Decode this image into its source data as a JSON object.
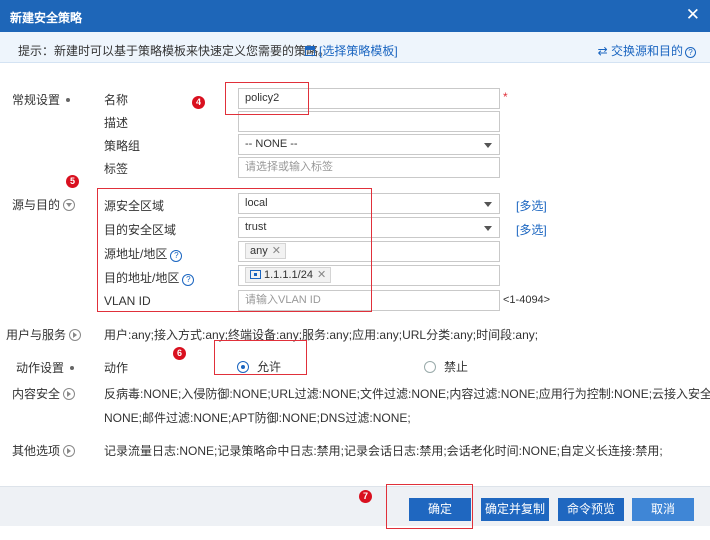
{
  "window": {
    "title": "新建安全策略",
    "close": "✕"
  },
  "hint": {
    "tip": "提示：新建时可以基于策略模板来快速定义您需要的策略。",
    "template_link": "[选择策略模板]",
    "swap": "⇄ 交换源和目的",
    "swap_help": "?"
  },
  "sections": {
    "general": "常规设置",
    "src_dst": "源与目的",
    "user_service": "用户与服务",
    "action": "动作设置",
    "content": "内容安全",
    "other": "其他选项"
  },
  "general": {
    "name_label": "名称",
    "name_value": "policy2",
    "required_mark": "*",
    "desc_label": "描述",
    "group_label": "策略组",
    "group_value": "-- NONE --",
    "tag_label": "标签",
    "tag_placeholder": "请选择或输入标签"
  },
  "srcdst": {
    "src_zone_label": "源安全区域",
    "src_zone_value": "local",
    "dst_zone_label": "目的安全区域",
    "dst_zone_value": "trust",
    "multi_label": "[多选]",
    "src_addr_label": "源地址/地区",
    "src_addr_tag": "any",
    "dst_addr_label": "目的地址/地区",
    "dst_addr_tag": "1.1.1.1/24",
    "vlan_label": "VLAN ID",
    "vlan_placeholder": "请输入VLAN ID",
    "vlan_range": "<1-4094>",
    "tag_remove": "✕",
    "help": "?"
  },
  "user_service_summary": "用户:any;接入方式:any;终端设备:any;服务:any;应用:any;URL分类:any;时间段:any;",
  "action": {
    "label": "动作",
    "permit": "允许",
    "deny": "禁止"
  },
  "content_summary_line1": "反病毒:NONE;入侵防御:NONE;URL过滤:NONE;文件过滤:NONE;内容过滤:NONE;应用行为控制:NONE;云接入安全感知:",
  "content_summary_line2": "NONE;邮件过滤:NONE;APT防御:NONE;DNS过滤:NONE;",
  "other_summary": "记录流量日志:NONE;记录策略命中日志:禁用;记录会话日志:禁用;会话老化时间:NONE;自定义长连接:禁用;",
  "badges": [
    "4",
    "5",
    "6",
    "7"
  ],
  "buttons": {
    "ok": "确定",
    "ok_copy": "确定并复制",
    "preview": "命令预览",
    "cancel": "取消"
  },
  "colors": {
    "title_bg": "#1e66b8",
    "accent": "#1a65c0",
    "annotation": "#e0303a"
  }
}
